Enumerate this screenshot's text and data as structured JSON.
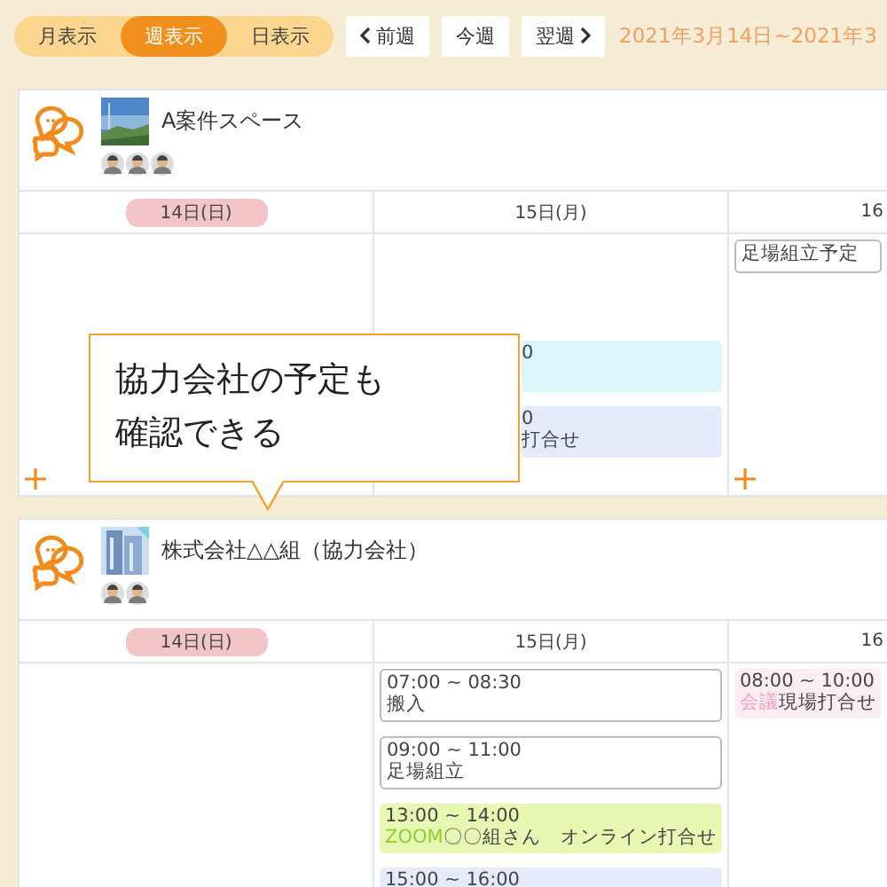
{
  "view_switch": [
    {
      "label": "月表示",
      "selected": false
    },
    {
      "label": "週表示",
      "selected": true
    },
    {
      "label": "日表示",
      "selected": false
    }
  ],
  "nav_buttons": [
    {
      "label": "前週",
      "kind": "prev"
    },
    {
      "label": "今週",
      "kind": "plain"
    },
    {
      "label": "翌週",
      "kind": "next"
    }
  ],
  "date_range": "2021年3月14日~2021年3",
  "spaces": [
    {
      "title": "A案件スペース",
      "members": [
        {
          "kind": "picture"
        },
        {
          "kind": "picture"
        },
        {
          "kind": "picture"
        }
      ],
      "days": [
        {
          "label": "14日(日)",
          "holiday": true
        },
        {
          "label": "15日(月)",
          "holiday": false
        },
        {
          "label": "16",
          "holiday": false
        }
      ],
      "cells": [
        {
          "add_button": true
        },
        {
          "covered": true,
          "events": [
            {
              "kind": "filled",
              "color": "#daf6fb",
              "time": "0"
            },
            {
              "kind": "filled",
              "color": "#e6ebfc",
              "time": "0",
              "title": "打合せ"
            }
          ]
        },
        {
          "add_button": true,
          "events": [
            {
              "kind": "outlined",
              "title": "足場組立予定"
            }
          ]
        }
      ]
    },
    {
      "title": "株式会社△△組（協力会社）",
      "members": [
        {
          "kind": "picture"
        },
        {
          "kind": "picture"
        }
      ],
      "days": [
        {
          "label": "14日(日)",
          "holiday": true
        },
        {
          "label": "15日(月)",
          "holiday": false
        },
        {
          "label": "16",
          "holiday": false
        }
      ],
      "cells": [
        {},
        {
          "events": [
            {
              "kind": "outlined",
              "time": "07:00 ~ 08:30",
              "title": "搬入"
            },
            {
              "kind": "outlined",
              "time": "09:00 ~ 11:00",
              "title": "足場組立"
            },
            {
              "kind": "filled",
              "color": "#e6f8b2",
              "time": "13:00 ~ 14:00",
              "tag": {
                "text": "ZOOM",
                "color": "#8ccf2e"
              },
              "title": "〇〇組さん　オンライン打合せ"
            },
            {
              "kind": "filled",
              "color": "#e6ebfc",
              "time": "15:00 ~ 16:00"
            }
          ]
        },
        {
          "events": [
            {
              "kind": "filled",
              "color": "#fdeef2",
              "time": "08:00 ~ 10:00",
              "tag": {
                "text": "会議",
                "color": "#f59ac0"
              },
              "title": "現場打合せ"
            }
          ]
        }
      ]
    }
  ],
  "callout": {
    "text": "協力会社の予定も確認できる"
  }
}
